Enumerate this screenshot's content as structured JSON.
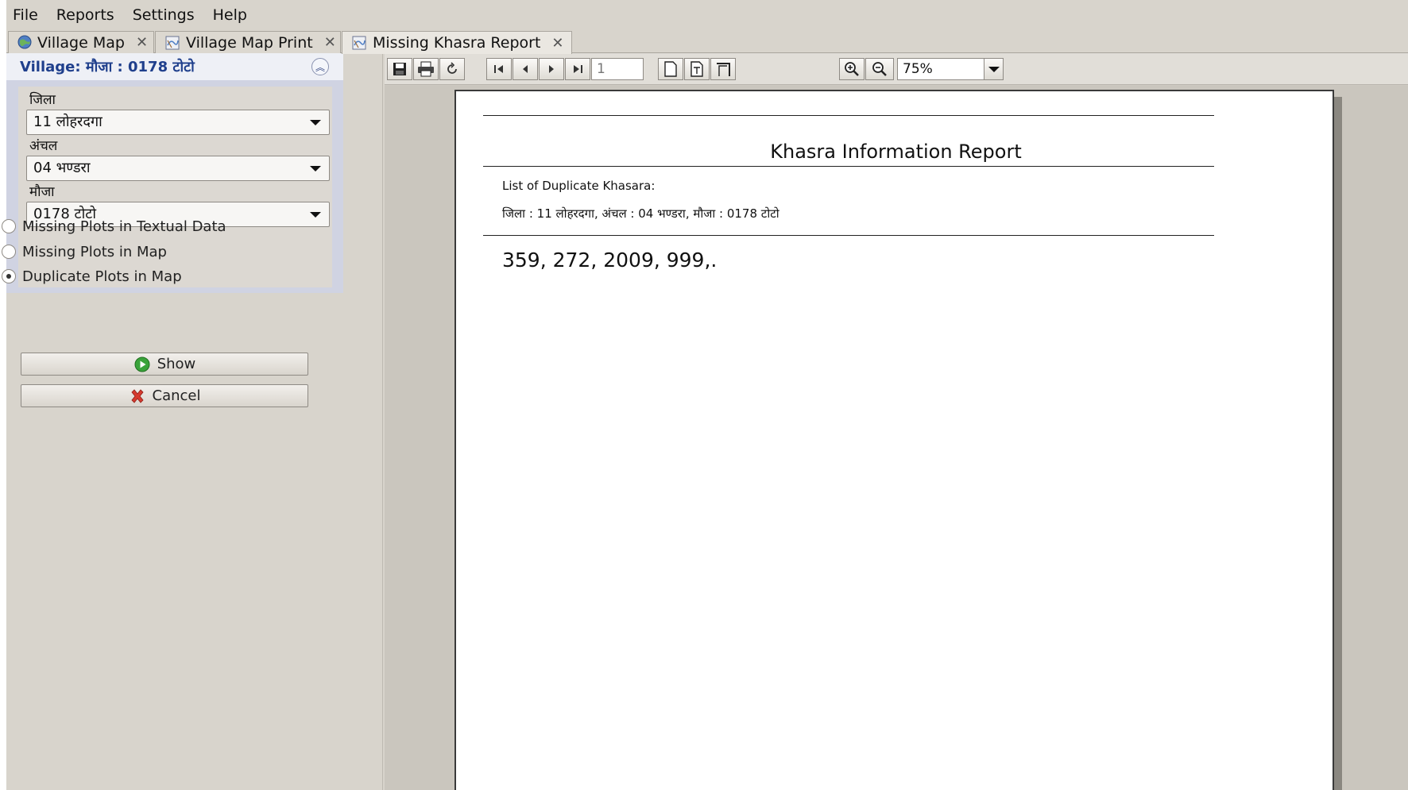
{
  "menu": [
    "File",
    "Reports",
    "Settings",
    "Help"
  ],
  "tabs": [
    {
      "label": "Village Map",
      "icon": "globe-icon"
    },
    {
      "label": "Village Map Print",
      "icon": "map-print-icon"
    },
    {
      "label": "Missing Khasra Report",
      "icon": "map-print-icon"
    }
  ],
  "left": {
    "village_title": "Village: मौजा : 0178 टोटो",
    "filters": [
      {
        "label": "जिला",
        "value": "11 लोहरदगा"
      },
      {
        "label": "अंचल",
        "value": "04 भण्डरा"
      },
      {
        "label": "मौजा",
        "value": "0178 टोटो"
      }
    ],
    "options": [
      {
        "label": "Missing Plots in Textual Data",
        "checked": false
      },
      {
        "label": "Missing Plots in Map",
        "checked": false
      },
      {
        "label": "Duplicate Plots in Map",
        "checked": true
      }
    ],
    "show_label": "Show",
    "cancel_label": "Cancel"
  },
  "toolbar": {
    "page_number": "1",
    "zoom": "75%"
  },
  "report": {
    "title": "Khasra Information Report",
    "subtitle": "List of Duplicate Khasara:",
    "location": "जिला : 11 लोहरदगा, अंचल : 04 भण्डरा, मौजा : 0178 टोटो",
    "values": "359, 272, 2009, 999,."
  }
}
